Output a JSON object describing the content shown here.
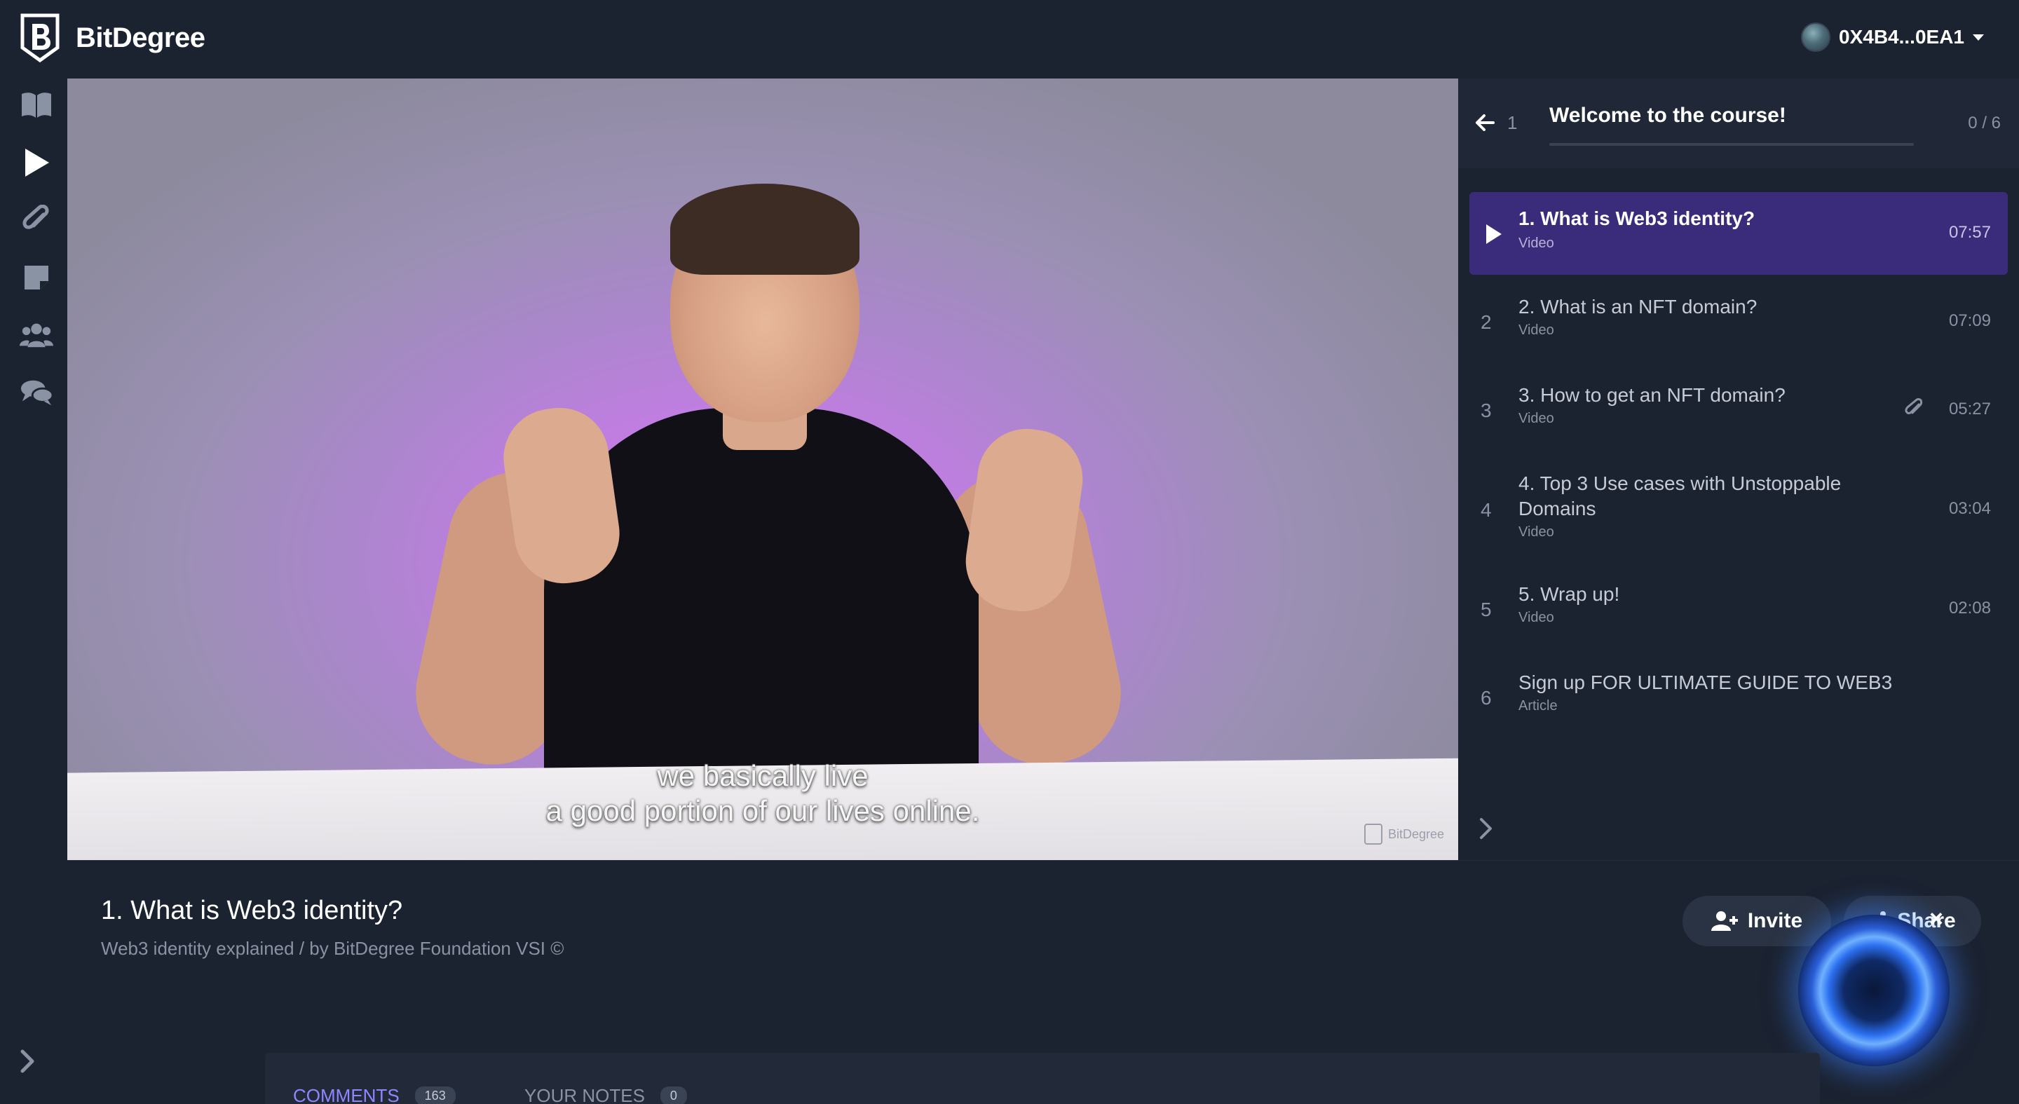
{
  "header": {
    "brand": "BitDegree",
    "wallet_address": "0X4B4...0EA1"
  },
  "nav": {
    "icons": [
      "book-icon",
      "play-icon",
      "paperclip-icon",
      "note-icon",
      "users-icon",
      "chat-icon",
      "chevron-right-icon"
    ]
  },
  "video": {
    "subtitle_line1": "we basically live",
    "subtitle_line2": "a good portion of our lives online.",
    "watermark": "BitDegree"
  },
  "course": {
    "section_number": "1",
    "section_title": "Welcome to the course!",
    "section_progress": "0 / 6",
    "lessons": [
      {
        "num": "",
        "title": "1. What is Web3 identity?",
        "type": "Video",
        "duration": "07:57",
        "active": true
      },
      {
        "num": "2",
        "title": "2. What is an NFT domain?",
        "type": "Video",
        "duration": "07:09"
      },
      {
        "num": "3",
        "title": "3. How to get an NFT domain?",
        "type": "Video",
        "duration": "05:27",
        "attachment": true
      },
      {
        "num": "4",
        "title": "4. Top 3 Use cases with Unstoppable Domains",
        "type": "Video",
        "duration": "03:04"
      },
      {
        "num": "5",
        "title": "5. Wrap up!",
        "type": "Video",
        "duration": "02:08"
      },
      {
        "num": "6",
        "title": "Sign up FOR ULTIMATE GUIDE TO WEB3",
        "type": "Article",
        "duration": ""
      }
    ]
  },
  "lesson_info": {
    "title": "1. What is Web3 identity?",
    "subtitle": "Web3 identity explained / by BitDegree Foundation VSI ©"
  },
  "actions": {
    "invite_label": "Invite",
    "share_label": "Share",
    "close_label": "×"
  },
  "tabs": {
    "comments_label": "COMMENTS",
    "comments_count": "163",
    "notes_label": "YOUR NOTES",
    "notes_count": "0"
  },
  "colors": {
    "background": "#1b2230",
    "accent": "#3a2c7a",
    "tab_active": "#8f86ff"
  }
}
